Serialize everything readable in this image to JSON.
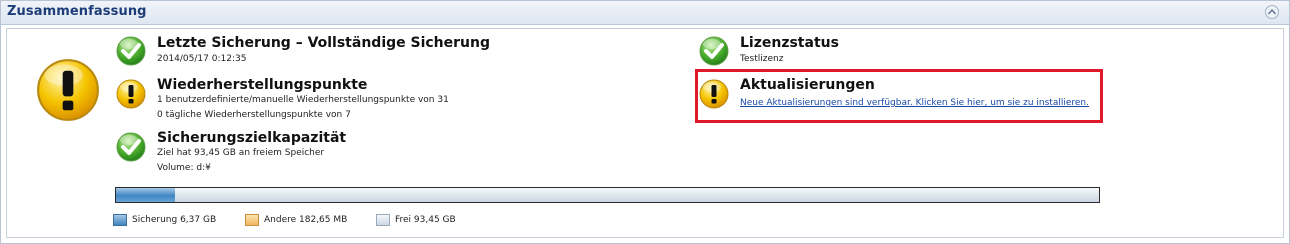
{
  "panel": {
    "title": "Zusammenfassung"
  },
  "items": {
    "last_backup": {
      "title": "Letzte Sicherung – Vollständige Sicherung",
      "line1": "2014/05/17 0:12:35",
      "status": "ok"
    },
    "restore_points": {
      "title": "Wiederherstellungspunkte",
      "line1": "1 benutzerdefinierte/manuelle Wiederherstellungspunkte von 31",
      "line2": "0 tägliche Wiederherstellungspunkte von 7",
      "status": "warning"
    },
    "target_capacity": {
      "title": "Sicherungszielkapazität",
      "line1": "Ziel hat 93,45 GB an freiem Speicher",
      "line2": "Volume: d:¥",
      "status": "ok"
    },
    "license": {
      "title": "Lizenzstatus",
      "line1": "Testlizenz",
      "status": "ok"
    },
    "updates": {
      "title": "Aktualisierungen",
      "link": "Neue Aktualisierungen sind verfügbar. Klicken Sie hier, um sie zu installieren.",
      "status": "warning"
    }
  },
  "storage": {
    "backup_fraction": 0.06,
    "legend": {
      "backup": "Sicherung 6,37 GB",
      "other": "Andere 182,65 MB",
      "free": "Frei 93,45 GB"
    }
  },
  "colors": {
    "ok": "#2f9a20",
    "warning": "#f2b400",
    "highlight": "#e0192a",
    "link": "#1a4aa8"
  }
}
